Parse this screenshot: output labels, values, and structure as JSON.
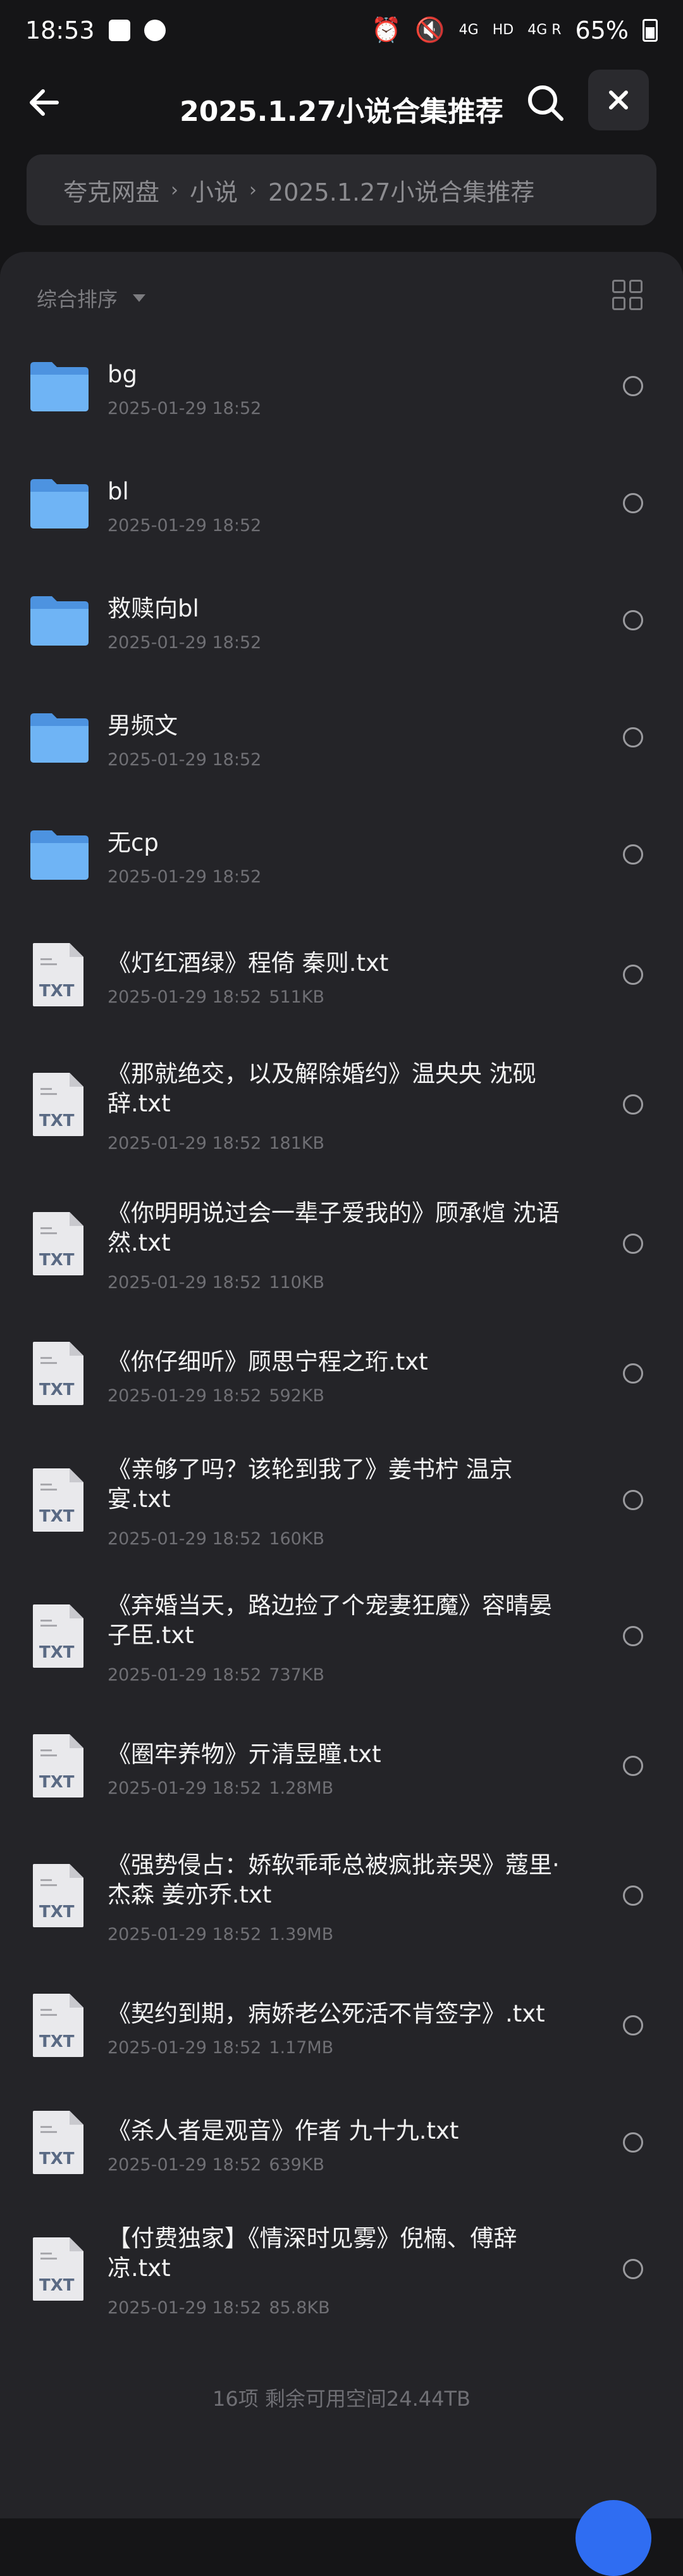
{
  "status_bar": {
    "time": "18:53",
    "network": "4G",
    "hd": "HD",
    "network2": "4G R",
    "battery_percent": "65%"
  },
  "header": {
    "title": "2025.1.27小说合集推荐",
    "icons": {
      "back": "arrow-left-icon",
      "search": "search-icon",
      "close": "close-icon"
    }
  },
  "breadcrumb": [
    "夸克网盘",
    "小说",
    "2025.1.27小说合集推荐"
  ],
  "toolbar": {
    "sort_label": "综合排序",
    "view_icon": "grid-view-icon"
  },
  "files": [
    {
      "name": "bg",
      "type": "folder",
      "date": "2025-01-29 18:52",
      "size": ""
    },
    {
      "name": "bl",
      "type": "folder",
      "date": "2025-01-29 18:52",
      "size": ""
    },
    {
      "name": "救赎向bl",
      "type": "folder",
      "date": "2025-01-29 18:52",
      "size": ""
    },
    {
      "name": "男频文",
      "type": "folder",
      "date": "2025-01-29 18:52",
      "size": ""
    },
    {
      "name": "无cp",
      "type": "folder",
      "date": "2025-01-29 18:52",
      "size": ""
    },
    {
      "name": "《灯红酒绿》程倚 秦则.txt",
      "type": "txt",
      "date": "2025-01-29 18:52",
      "size": "511KB"
    },
    {
      "name": "《那就绝交，以及解除婚约》温央央 沈砚辞.txt",
      "type": "txt",
      "date": "2025-01-29 18:52",
      "size": "181KB"
    },
    {
      "name": "《你明明说过会一辈子爱我的》顾承煊 沈语然.txt",
      "type": "txt",
      "date": "2025-01-29 18:52",
      "size": "110KB"
    },
    {
      "name": "《你仔细听》顾思宁程之珩.txt",
      "type": "txt",
      "date": "2025-01-29 18:52",
      "size": "592KB"
    },
    {
      "name": "《亲够了吗？该轮到我了》姜书柠 温京宴.txt",
      "type": "txt",
      "date": "2025-01-29 18:52",
      "size": "160KB"
    },
    {
      "name": "《弃婚当天，路边捡了个宠妻狂魔》容晴晏子臣.txt",
      "type": "txt",
      "date": "2025-01-29 18:52",
      "size": "737KB"
    },
    {
      "name": "《圈牢养物》亓清昱瞳.txt",
      "type": "txt",
      "date": "2025-01-29 18:52",
      "size": "1.28MB"
    },
    {
      "name": "《强势侵占：娇软乖乖总被疯批亲哭》蔻里·杰森 姜亦乔.txt",
      "type": "txt",
      "date": "2025-01-29 18:52",
      "size": "1.39MB"
    },
    {
      "name": "《契约到期，病娇老公死活不肯签字》.txt",
      "type": "txt",
      "date": "2025-01-29 18:52",
      "size": "1.17MB"
    },
    {
      "name": "《杀人者是观音》作者 九十九.txt",
      "type": "txt",
      "date": "2025-01-29 18:52",
      "size": "639KB"
    },
    {
      "name": "【付费独家】《情深时见雾》倪楠、傅辞凉.txt",
      "type": "txt",
      "date": "2025-01-29 18:52",
      "size": "85.8KB"
    }
  ],
  "footer": {
    "summary": "16项 剩余可用空间24.44TB"
  },
  "icon_labels": {
    "txt": "TXT"
  },
  "colors": {
    "background": "#151517",
    "panel": "#242428",
    "accent": "#2f6df2",
    "folder": "#5aa6f0"
  }
}
